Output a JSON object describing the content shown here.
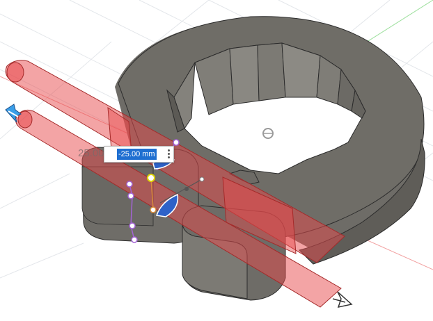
{
  "viewport": {
    "dimension_ghost_text": "25.00",
    "dimension_value": "-25.00 mm"
  },
  "colors": {
    "model_body": "#7c7a74",
    "model_top": "#6d6b66",
    "highlight_red": "#e8494c",
    "handle_blue": "#2e62c8",
    "manipulator_purple": "#a463d6",
    "pivot_yellow": "#e0d600"
  }
}
